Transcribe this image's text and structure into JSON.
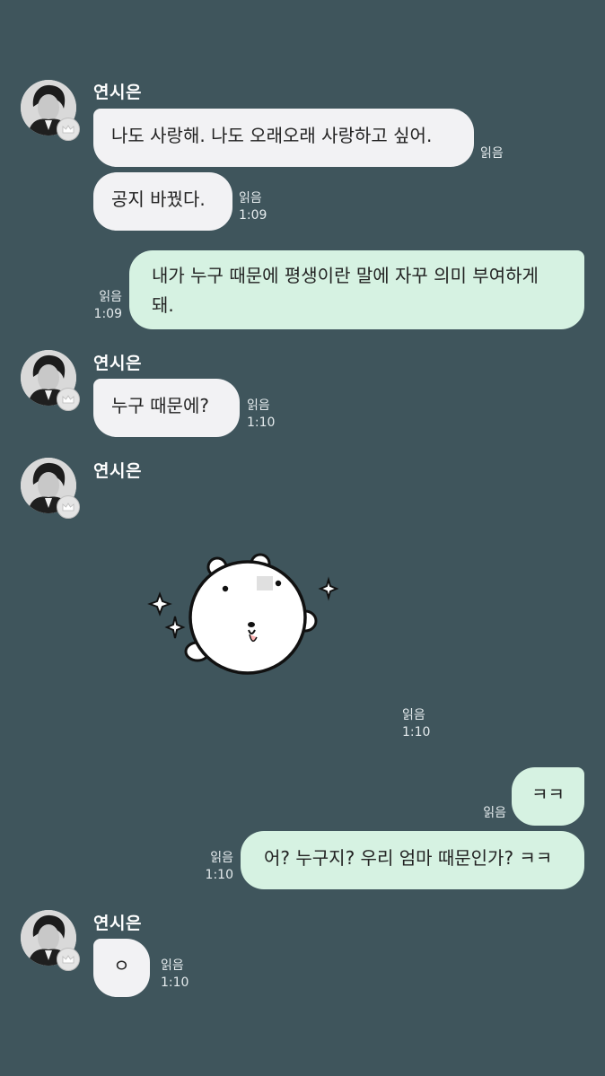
{
  "chat": {
    "messages": [
      {
        "id": "m1",
        "sender": "연시은",
        "text": "나도 사랑해. 나도 오래오래 사랑하고 싶어.",
        "read": "읽음",
        "time": ""
      },
      {
        "id": "m2",
        "sender": "연시은",
        "text": "공지 바꿨다.",
        "read": "읽음",
        "time": "1:09"
      },
      {
        "id": "m3",
        "sender": "me",
        "text": "내가 누구 때문에 평생이란 말에 자꾸 의미 부여하게 돼.",
        "read": "읽음",
        "time": "1:09"
      },
      {
        "id": "m4",
        "sender": "연시은",
        "text": "누구 때문에?",
        "read": "읽음",
        "time": "1:10"
      },
      {
        "id": "m5",
        "sender": "연시은",
        "sticker": "white-bear-sticker",
        "read": "읽음",
        "time": "1:10"
      },
      {
        "id": "m6",
        "sender": "me",
        "text": "ㅋㅋ",
        "read": "읽음",
        "time": ""
      },
      {
        "id": "m7",
        "sender": "me",
        "text": "어? 누구지? 우리 엄마 때문인가? ㅋㅋ",
        "read": "읽음",
        "time": "1:10"
      },
      {
        "id": "m8",
        "sender": "연시은",
        "text": "ㅇ",
        "read": "읽음",
        "time": "1:10"
      }
    ]
  },
  "colors": {
    "background": "#3f555c",
    "incoming_bubble": "#f2f2f4",
    "outgoing_bubble": "#d6f2e2",
    "meta_text": "#e6ecee"
  },
  "icons": {
    "avatar": "profile-photo",
    "badge": "crown-icon"
  }
}
